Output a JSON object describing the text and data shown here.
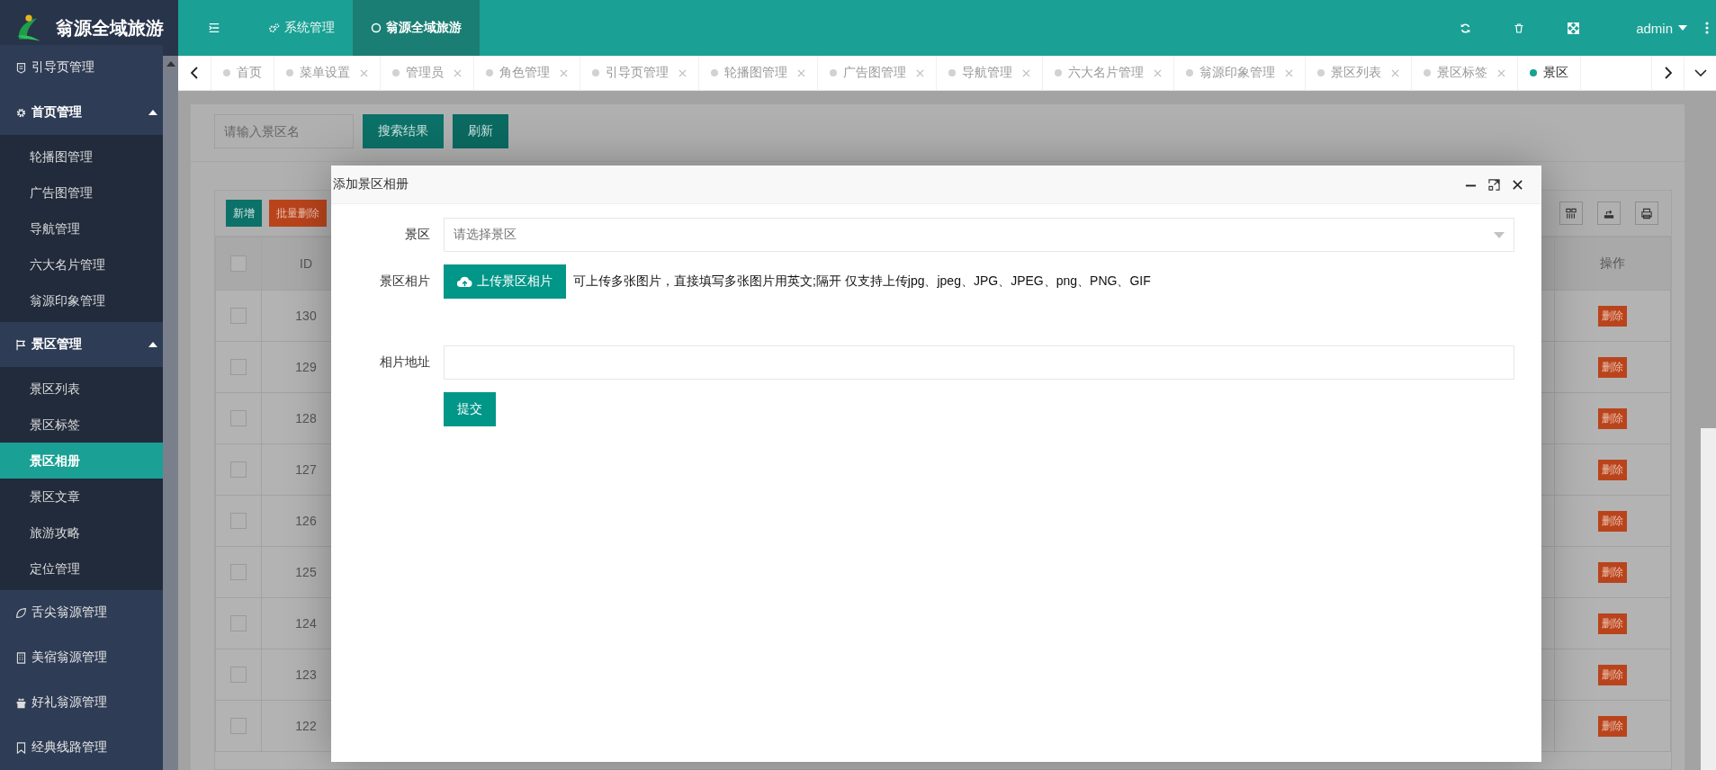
{
  "brand": {
    "title": "翁源全域旅游"
  },
  "top_nav": [
    {
      "label": "系统管理",
      "selected": false
    },
    {
      "label": "翁源全域旅游",
      "selected": true
    }
  ],
  "user": {
    "name": "admin"
  },
  "sidebar": {
    "items": [
      {
        "label": "引导页管理",
        "expanded": false
      },
      {
        "label": "首页管理",
        "expanded": true,
        "children": [
          {
            "label": "轮播图管理",
            "selected": false
          },
          {
            "label": "广告图管理",
            "selected": false
          },
          {
            "label": "导航管理",
            "selected": false
          },
          {
            "label": "六大名片管理",
            "selected": false
          },
          {
            "label": "翁源印象管理",
            "selected": false
          }
        ]
      },
      {
        "label": "景区管理",
        "expanded": true,
        "children": [
          {
            "label": "景区列表",
            "selected": false
          },
          {
            "label": "景区标签",
            "selected": false
          },
          {
            "label": "景区相册",
            "selected": true
          },
          {
            "label": "景区文章",
            "selected": false
          },
          {
            "label": "旅游攻略",
            "selected": false
          },
          {
            "label": "定位管理",
            "selected": false
          }
        ]
      },
      {
        "label": "舌尖翁源管理",
        "expanded": false
      },
      {
        "label": "美宿翁源管理",
        "expanded": false
      },
      {
        "label": "好礼翁源管理",
        "expanded": false
      },
      {
        "label": "经典线路管理",
        "expanded": false
      }
    ]
  },
  "tabs": [
    {
      "label": "首页",
      "selected": false,
      "closable": false
    },
    {
      "label": "菜单设置",
      "selected": false,
      "closable": true
    },
    {
      "label": "管理员",
      "selected": false,
      "closable": true
    },
    {
      "label": "角色管理",
      "selected": false,
      "closable": true
    },
    {
      "label": "引导页管理",
      "selected": false,
      "closable": true
    },
    {
      "label": "轮播图管理",
      "selected": false,
      "closable": true
    },
    {
      "label": "广告图管理",
      "selected": false,
      "closable": true
    },
    {
      "label": "导航管理",
      "selected": false,
      "closable": true
    },
    {
      "label": "六大名片管理",
      "selected": false,
      "closable": true
    },
    {
      "label": "翁源印象管理",
      "selected": false,
      "closable": true
    },
    {
      "label": "景区列表",
      "selected": false,
      "closable": true
    },
    {
      "label": "景区标签",
      "selected": false,
      "closable": true
    },
    {
      "label": "景区",
      "selected": true,
      "closable": false
    }
  ],
  "search": {
    "placeholder": "请输入景区名",
    "buttons": [
      "搜索结果",
      "刷新"
    ]
  },
  "toolbar": {
    "buttons": [
      {
        "label": "新增",
        "kind": "primary"
      },
      {
        "label": "批量删除",
        "kind": "danger"
      }
    ]
  },
  "table": {
    "columns": [
      "ID",
      "操作"
    ],
    "header_checked": false,
    "rows": [
      {
        "id": "130",
        "checked": false,
        "action": "删除"
      },
      {
        "id": "129",
        "checked": false,
        "action": "删除"
      },
      {
        "id": "128",
        "checked": false,
        "action": "删除"
      },
      {
        "id": "127",
        "checked": false,
        "action": "删除"
      },
      {
        "id": "126",
        "checked": false,
        "action": "删除"
      },
      {
        "id": "125",
        "checked": false,
        "action": "删除"
      },
      {
        "id": "124",
        "checked": false,
        "action": "删除"
      },
      {
        "id": "123",
        "checked": false,
        "action": "删除"
      },
      {
        "id": "122",
        "checked": false,
        "action": "删除"
      }
    ]
  },
  "dialog": {
    "title": "添加景区相册",
    "fields": [
      {
        "kind": "select",
        "label": "景区",
        "placeholder": "请选择景区"
      },
      {
        "kind": "upload",
        "label": "景区相片",
        "button": "上传景区相片",
        "hint": "可上传多张图片，直接填写多张图片用英文;隔开 仅支持上传jpg、jpeg、JPG、JPEG、png、PNG、GIF"
      },
      {
        "kind": "input",
        "label": "相片地址"
      }
    ],
    "submit": "提交"
  }
}
